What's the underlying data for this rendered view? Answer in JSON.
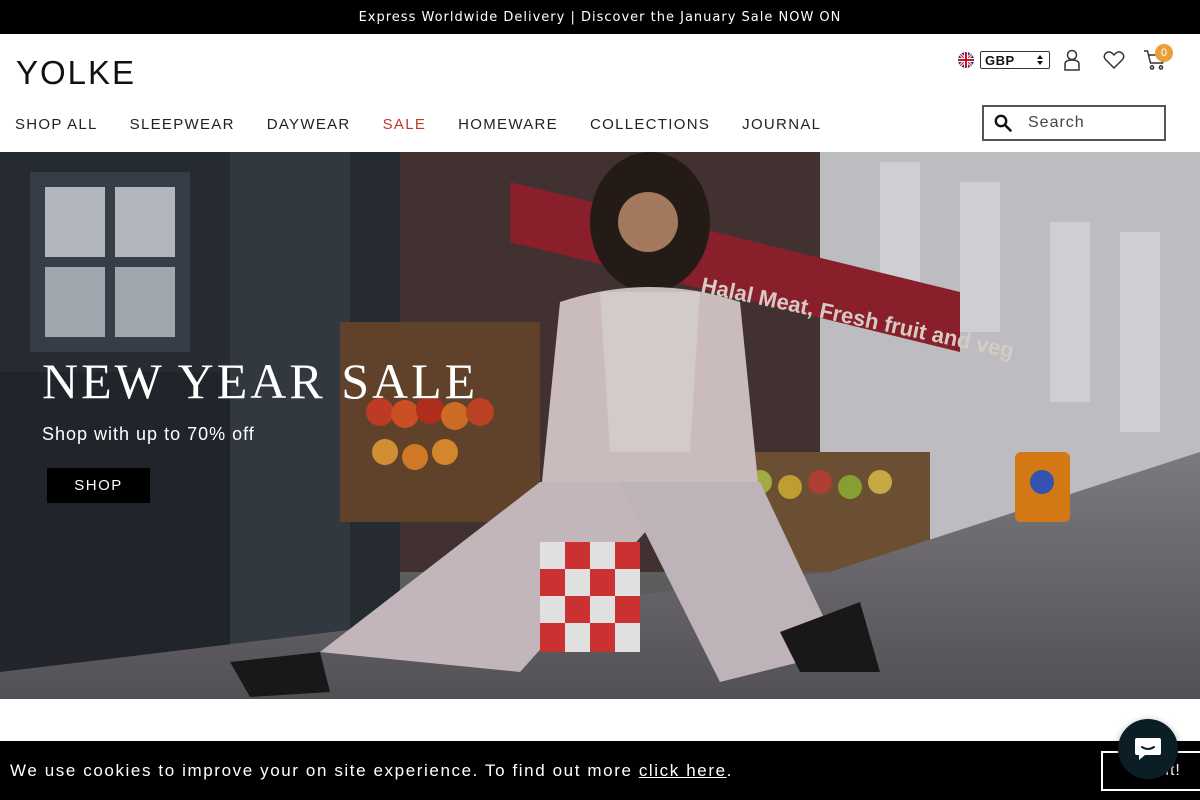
{
  "announcement": {
    "text": "Express Worldwide Delivery | Discover the January Sale NOW ON"
  },
  "header": {
    "logo": "YOLKE",
    "currency": {
      "selected": "GBP",
      "flag": "uk-flag-icon"
    },
    "icons": [
      "account-icon",
      "wishlist-heart-icon",
      "cart-icon"
    ],
    "cart_count": "0"
  },
  "nav": {
    "items": [
      {
        "label": "SHOP ALL"
      },
      {
        "label": "SLEEPWEAR"
      },
      {
        "label": "DAYWEAR"
      },
      {
        "label": "SALE",
        "color": "#c0392b"
      },
      {
        "label": "HOMEWARE"
      },
      {
        "label": "COLLECTIONS"
      },
      {
        "label": "JOURNAL"
      }
    ]
  },
  "search": {
    "placeholder": "Search",
    "value": ""
  },
  "hero": {
    "title": "NEW YEAR SALE",
    "subtitle": "Shop with up to 70% off",
    "button_label": "SHOP"
  },
  "cookie": {
    "text": "We use cookies to improve your on site experience. To find out more ",
    "link_label": "click here",
    "suffix": ".",
    "button_label": "Got it!"
  },
  "chat": {
    "icon": "chat-bubble-icon"
  },
  "colors": {
    "announcement_bg": "#000000",
    "sale_accent": "#c0392b",
    "cart_badge": "#e8a13a",
    "chat_bg": "#0b1e26"
  }
}
